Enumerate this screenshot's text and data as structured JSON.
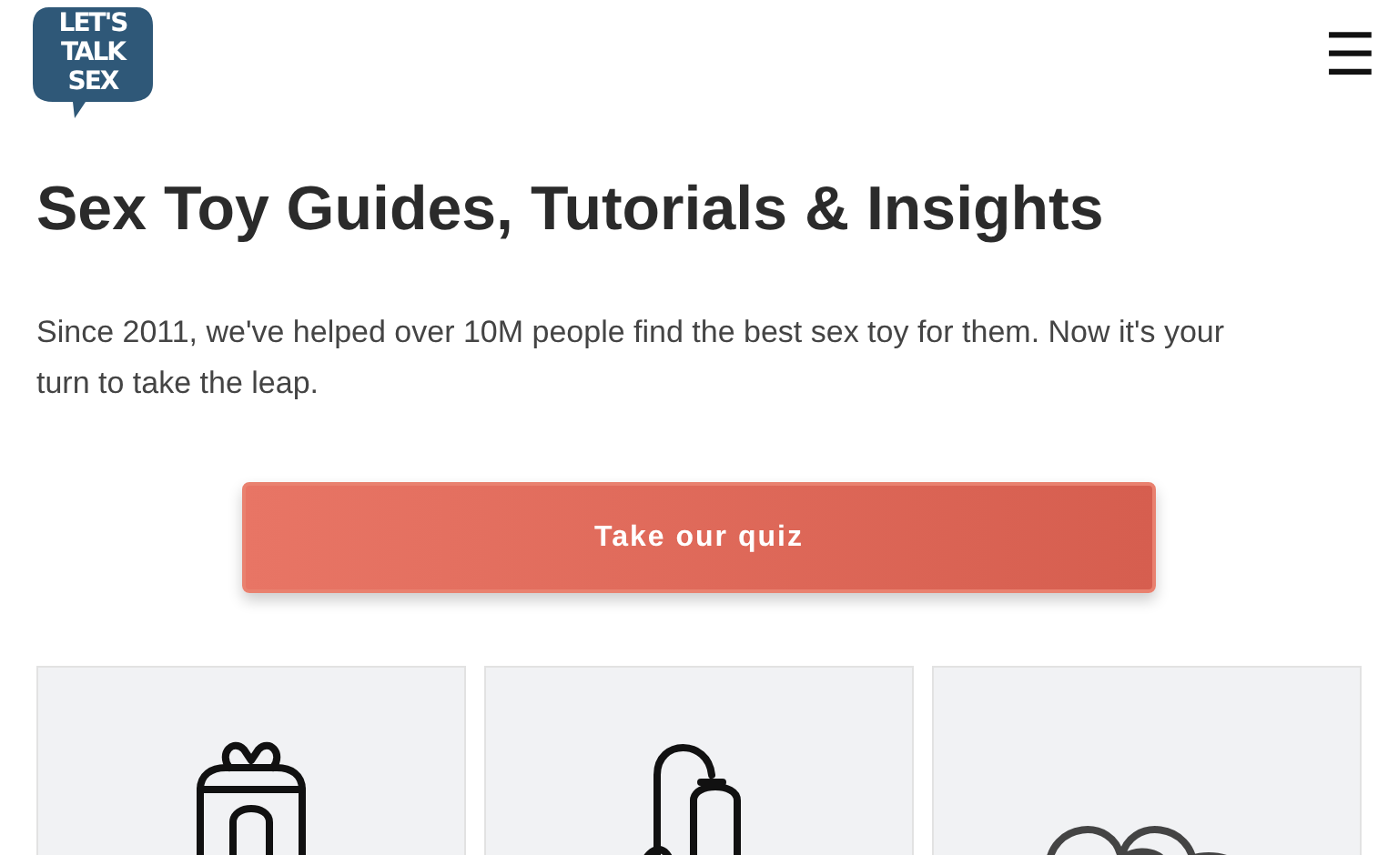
{
  "header": {
    "logo_lines": [
      "LET'S",
      "TALK",
      "SEX"
    ],
    "menu_icon": "☰"
  },
  "hero": {
    "title": "Sex Toy Guides, Tutorials & Insights",
    "text": "Since 2011, we've helped over 10M people find the best sex toy for them. Now it's your turn to take the leap.",
    "button": "Take our quiz"
  },
  "cards": [
    {
      "kind": "gift"
    },
    {
      "kind": "pump"
    },
    {
      "kind": "rings"
    }
  ]
}
